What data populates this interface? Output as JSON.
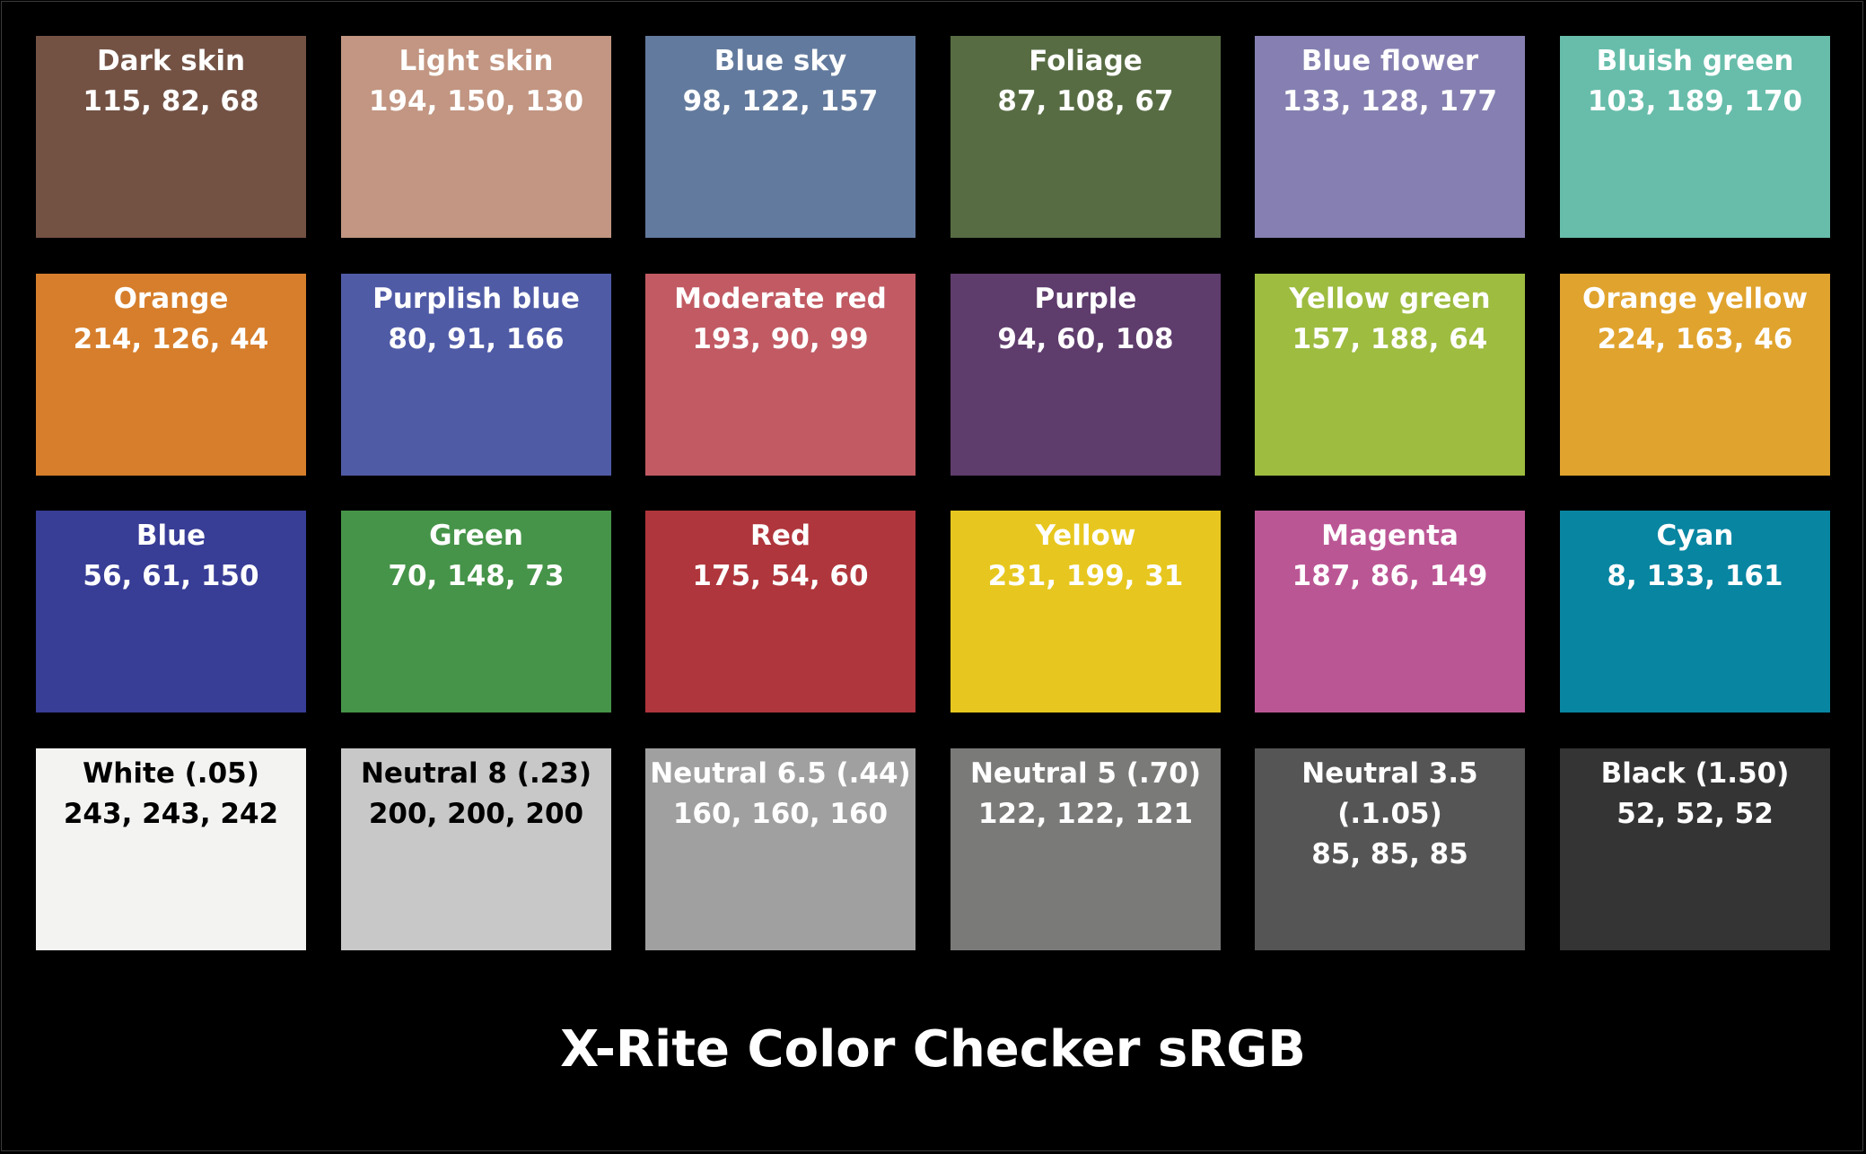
{
  "title": "X-Rite Color Checker sRGB",
  "patches": [
    {
      "name": "Dark skin",
      "rgb": "115, 82, 68",
      "fill": "#735244",
      "text_color": "#ffffff"
    },
    {
      "name": "Light skin",
      "rgb": "194, 150, 130",
      "fill": "#c29682",
      "text_color": "#ffffff"
    },
    {
      "name": "Blue sky",
      "rgb": "98, 122, 157",
      "fill": "#627a9d",
      "text_color": "#ffffff"
    },
    {
      "name": "Foliage",
      "rgb": "87, 108, 67",
      "fill": "#576c43",
      "text_color": "#ffffff"
    },
    {
      "name": "Blue flower",
      "rgb": "133, 128, 177",
      "fill": "#8580b1",
      "text_color": "#ffffff"
    },
    {
      "name": "Bluish green",
      "rgb": "103, 189, 170",
      "fill": "#67bdaa",
      "text_color": "#ffffff"
    },
    {
      "name": "Orange",
      "rgb": "214, 126, 44",
      "fill": "#d67e2c",
      "text_color": "#ffffff"
    },
    {
      "name": "Purplish blue",
      "rgb": "80, 91, 166",
      "fill": "#505ba6",
      "text_color": "#ffffff"
    },
    {
      "name": "Moderate red",
      "rgb": "193, 90, 99",
      "fill": "#c15a63",
      "text_color": "#ffffff"
    },
    {
      "name": "Purple",
      "rgb": "94, 60, 108",
      "fill": "#5e3c6c",
      "text_color": "#ffffff"
    },
    {
      "name": "Yellow green",
      "rgb": "157, 188, 64",
      "fill": "#9dbc40",
      "text_color": "#ffffff"
    },
    {
      "name": "Orange yellow",
      "rgb": "224, 163, 46",
      "fill": "#e0a32e",
      "text_color": "#ffffff"
    },
    {
      "name": "Blue",
      "rgb": "56, 61, 150",
      "fill": "#383d96",
      "text_color": "#ffffff"
    },
    {
      "name": "Green",
      "rgb": "70, 148, 73",
      "fill": "#469449",
      "text_color": "#ffffff"
    },
    {
      "name": "Red",
      "rgb": "175, 54, 60",
      "fill": "#af363c",
      "text_color": "#ffffff"
    },
    {
      "name": "Yellow",
      "rgb": "231, 199, 31",
      "fill": "#e7c71f",
      "text_color": "#ffffff"
    },
    {
      "name": "Magenta",
      "rgb": "187, 86, 149",
      "fill": "#bb5695",
      "text_color": "#ffffff"
    },
    {
      "name": "Cyan",
      "rgb": "8, 133, 161",
      "fill": "#0885a1",
      "text_color": "#ffffff"
    },
    {
      "name": "White (.05)",
      "rgb": "243, 243, 242",
      "fill": "#f3f3f2",
      "text_color": "#000000"
    },
    {
      "name": "Neutral 8 (.23)",
      "rgb": "200, 200, 200",
      "fill": "#c8c8c8",
      "text_color": "#000000"
    },
    {
      "name": "Neutral 6.5 (.44)",
      "rgb": "160, 160, 160",
      "fill": "#a0a0a0",
      "text_color": "#ffffff"
    },
    {
      "name": "Neutral 5 (.70)",
      "rgb": "122, 122, 121",
      "fill": "#7a7a79",
      "text_color": "#ffffff"
    },
    {
      "name": "Neutral 3.5",
      "name_line2": "(.1.05)",
      "rgb": "85, 85, 85",
      "fill": "#555555",
      "text_color": "#ffffff"
    },
    {
      "name": "Black (1.50)",
      "rgb": "52, 52, 52",
      "fill": "#343434",
      "text_color": "#ffffff"
    }
  ]
}
